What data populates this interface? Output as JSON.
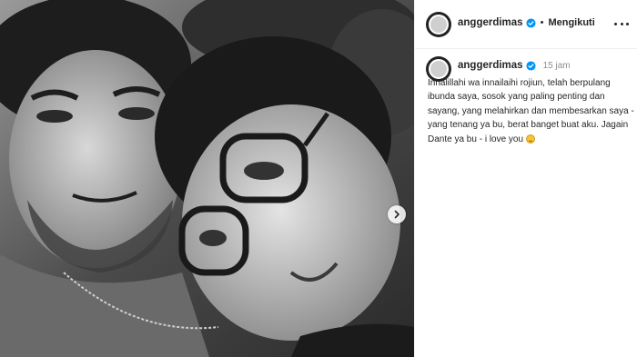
{
  "post": {
    "username": "anggerdimas",
    "follow_status": "Mengikuti",
    "separator": "•",
    "time_ago": "15 jam",
    "caption": "Innalillahi wa innailaihi rojiun, telah berpulang ibunda saya, sosok yang paling penting dan sayang, yang melahirkan dan membesarkan saya - yang tenang ya bu, berat banget buat aku. Jagain Dante ya bu - i love you",
    "caption_emoji": "smiling-face-emoji"
  },
  "icons": {
    "verified": "verified-badge-icon",
    "more": "more-options-icon",
    "next": "chevron-right-icon"
  },
  "colors": {
    "verified_blue": "#0095f6",
    "text": "#262626",
    "muted": "#8e8e8e"
  }
}
